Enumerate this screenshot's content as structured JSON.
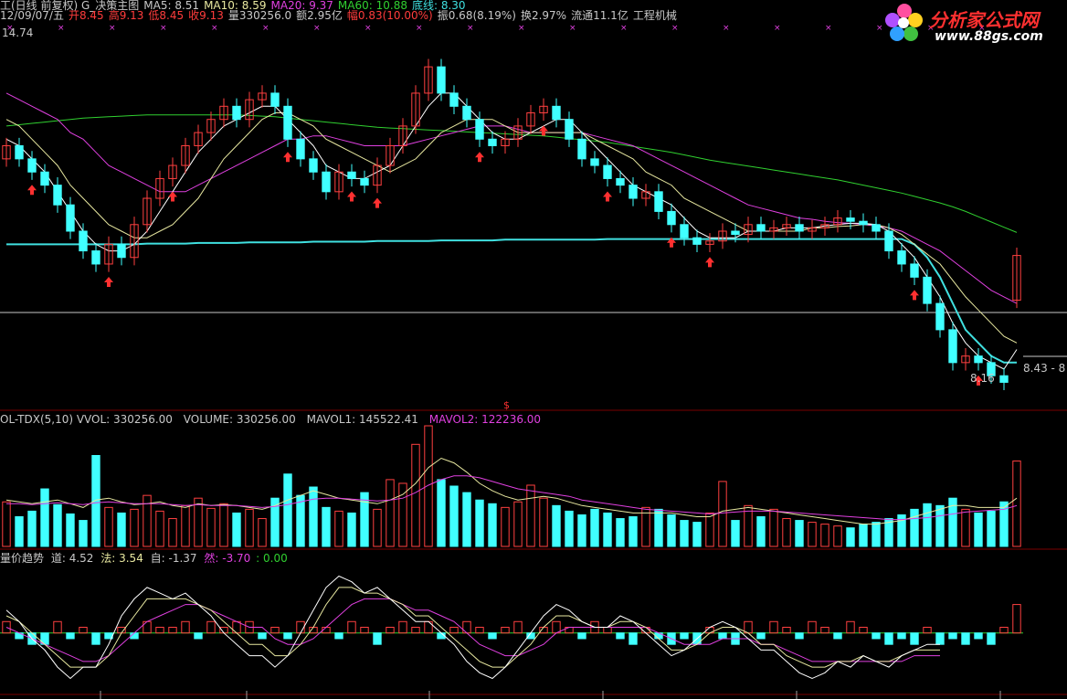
{
  "header": {
    "line1": [
      {
        "text": "工(日线 前复权) G_决策主图",
        "color": "#c8c8c8"
      },
      {
        "text": "MA5: 8.51",
        "color": "#c8c8c8"
      },
      {
        "text": "MA10: 8.59",
        "color": "#e8e8a0"
      },
      {
        "text": "MA20: 9.37",
        "color": "#e040e0"
      },
      {
        "text": "MA60: 10.88",
        "color": "#30d030"
      },
      {
        "text": "底线: 8.30",
        "color": "#40e0e0"
      }
    ],
    "line2": [
      {
        "text": "12/09/07/五",
        "color": "#c8c8c8"
      },
      {
        "text": "开8.45",
        "color": "#ff3c3c"
      },
      {
        "text": "高9.13",
        "color": "#ff3c3c"
      },
      {
        "text": "低8.45",
        "color": "#ff3c3c"
      },
      {
        "text": "收9.13",
        "color": "#ff3c3c"
      },
      {
        "text": "量330256.0",
        "color": "#c8c8c8"
      },
      {
        "text": "额2.95亿",
        "color": "#c8c8c8"
      },
      {
        "text": "幅0.83(10.00%)",
        "color": "#ff3c3c"
      },
      {
        "text": "振0.68(8.19%)",
        "color": "#c8c8c8"
      },
      {
        "text": "换2.97%",
        "color": "#c8c8c8"
      },
      {
        "text": "流通11.1亿",
        "color": "#c8c8c8"
      },
      {
        "text": "工程机械",
        "color": "#c8c8c8"
      }
    ]
  },
  "logo": {
    "title": "分析家公式网",
    "url": "www.88gs.com"
  },
  "chart_data": [
    {
      "type": "candlestick",
      "name": "price",
      "y_max_label": "14.74",
      "low_label": "8.16",
      "last_label": "8.43 - 8",
      "marker_label": "$",
      "close": [
        10.8,
        10.6,
        10.4,
        10.2,
        9.9,
        9.5,
        9.2,
        9.0,
        9.3,
        9.1,
        9.6,
        10.0,
        10.3,
        10.5,
        10.8,
        11.0,
        11.2,
        11.4,
        11.2,
        11.5,
        11.6,
        11.4,
        10.9,
        10.6,
        10.4,
        10.1,
        10.4,
        10.3,
        10.2,
        10.5,
        10.8,
        11.1,
        11.6,
        12.0,
        11.6,
        11.4,
        11.2,
        10.9,
        10.8,
        10.9,
        11.1,
        11.3,
        11.4,
        11.2,
        10.9,
        10.6,
        10.5,
        10.3,
        10.2,
        10.0,
        10.1,
        9.8,
        9.6,
        9.4,
        9.3,
        9.35,
        9.5,
        9.45,
        9.6,
        9.5,
        9.55,
        9.6,
        9.5,
        9.55,
        9.6,
        9.7,
        9.65,
        9.6,
        9.5,
        9.2,
        9.0,
        8.8,
        8.4,
        8.0,
        7.5,
        7.6,
        7.5,
        7.3,
        7.2,
        9.13
      ],
      "open": [
        10.6,
        10.8,
        10.6,
        10.4,
        10.2,
        9.9,
        9.5,
        9.2,
        9.0,
        9.3,
        9.1,
        9.6,
        10.0,
        10.3,
        10.5,
        10.8,
        11.0,
        11.2,
        11.4,
        11.2,
        11.5,
        11.6,
        11.4,
        10.9,
        10.6,
        10.4,
        10.1,
        10.4,
        10.3,
        10.2,
        10.5,
        10.8,
        11.1,
        11.6,
        12.0,
        11.6,
        11.4,
        11.2,
        10.9,
        10.8,
        10.9,
        11.1,
        11.3,
        11.4,
        11.2,
        10.9,
        10.6,
        10.5,
        10.3,
        10.2,
        10.0,
        10.1,
        9.8,
        9.6,
        9.4,
        9.3,
        9.35,
        9.5,
        9.45,
        9.6,
        9.5,
        9.55,
        9.6,
        9.5,
        9.55,
        9.6,
        9.7,
        9.65,
        9.6,
        9.5,
        9.2,
        9.0,
        8.8,
        8.4,
        8.0,
        7.5,
        7.6,
        7.5,
        7.3,
        8.45
      ],
      "ma5": [
        10.9,
        10.8,
        10.6,
        10.4,
        10.1,
        9.8,
        9.5,
        9.3,
        9.2,
        9.2,
        9.3,
        9.5,
        9.8,
        10.1,
        10.4,
        10.7,
        10.9,
        11.1,
        11.2,
        11.3,
        11.4,
        11.4,
        11.2,
        11.0,
        10.8,
        10.5,
        10.4,
        10.3,
        10.3,
        10.4,
        10.5,
        10.8,
        11.1,
        11.4,
        11.6,
        11.6,
        11.4,
        11.2,
        11.0,
        10.9,
        10.9,
        11.0,
        11.1,
        11.2,
        11.2,
        11.0,
        10.8,
        10.6,
        10.4,
        10.2,
        10.1,
        10.0,
        9.9,
        9.7,
        9.5,
        9.4,
        9.4,
        9.4,
        9.5,
        9.5,
        9.5,
        9.55,
        9.55,
        9.55,
        9.58,
        9.6,
        9.62,
        9.62,
        9.6,
        9.5,
        9.3,
        9.1,
        8.8,
        8.5,
        8.1,
        7.8,
        7.6,
        7.5,
        7.4,
        7.7
      ],
      "ma10": [
        11.2,
        11.1,
        10.9,
        10.7,
        10.5,
        10.2,
        10.0,
        9.8,
        9.6,
        9.5,
        9.4,
        9.4,
        9.5,
        9.6,
        9.8,
        10.0,
        10.3,
        10.6,
        10.8,
        11.0,
        11.2,
        11.3,
        11.3,
        11.2,
        11.1,
        10.9,
        10.8,
        10.7,
        10.6,
        10.5,
        10.4,
        10.5,
        10.6,
        10.8,
        11.0,
        11.1,
        11.2,
        11.2,
        11.2,
        11.1,
        11.0,
        11.0,
        11.0,
        11.0,
        11.0,
        11.0,
        10.9,
        10.8,
        10.7,
        10.6,
        10.4,
        10.3,
        10.2,
        10.0,
        9.9,
        9.8,
        9.7,
        9.6,
        9.5,
        9.5,
        9.5,
        9.5,
        9.5,
        9.55,
        9.55,
        9.57,
        9.58,
        9.6,
        9.6,
        9.55,
        9.45,
        9.3,
        9.15,
        9.0,
        8.75,
        8.5,
        8.3,
        8.1,
        7.9,
        7.8
      ],
      "ma20": [
        11.6,
        11.5,
        11.4,
        11.3,
        11.2,
        11.0,
        10.9,
        10.7,
        10.5,
        10.4,
        10.3,
        10.2,
        10.1,
        10.1,
        10.1,
        10.2,
        10.3,
        10.4,
        10.5,
        10.6,
        10.7,
        10.8,
        10.9,
        10.9,
        10.95,
        10.95,
        10.9,
        10.85,
        10.8,
        10.8,
        10.8,
        10.8,
        10.85,
        10.9,
        10.95,
        11.0,
        11.05,
        11.1,
        11.1,
        11.1,
        11.05,
        11.0,
        11.0,
        11.0,
        11.0,
        11.0,
        10.95,
        10.9,
        10.85,
        10.8,
        10.7,
        10.6,
        10.5,
        10.4,
        10.3,
        10.2,
        10.1,
        10.0,
        9.9,
        9.85,
        9.8,
        9.75,
        9.7,
        9.68,
        9.65,
        9.63,
        9.62,
        9.6,
        9.58,
        9.55,
        9.5,
        9.4,
        9.3,
        9.2,
        9.05,
        8.9,
        8.75,
        8.6,
        8.5,
        8.4
      ],
      "ma60": [
        11.1,
        11.12,
        11.14,
        11.16,
        11.18,
        11.2,
        11.22,
        11.23,
        11.24,
        11.25,
        11.26,
        11.27,
        11.27,
        11.27,
        11.27,
        11.27,
        11.27,
        11.27,
        11.27,
        11.26,
        11.25,
        11.24,
        11.22,
        11.2,
        11.18,
        11.16,
        11.14,
        11.12,
        11.1,
        11.08,
        11.07,
        11.06,
        11.05,
        11.04,
        11.03,
        11.02,
        11.01,
        11.0,
        10.99,
        10.98,
        10.97,
        10.96,
        10.95,
        10.93,
        10.91,
        10.89,
        10.87,
        10.85,
        10.82,
        10.79,
        10.76,
        10.73,
        10.7,
        10.66,
        10.62,
        10.58,
        10.55,
        10.52,
        10.49,
        10.46,
        10.43,
        10.4,
        10.37,
        10.34,
        10.31,
        10.28,
        10.24,
        10.2,
        10.16,
        10.12,
        10.08,
        10.03,
        9.98,
        9.93,
        9.87,
        9.8,
        9.72,
        9.64,
        9.56,
        9.48
      ],
      "base": [
        9.3,
        9.3,
        9.3,
        9.3,
        9.3,
        9.3,
        9.3,
        9.3,
        9.3,
        9.3,
        9.3,
        9.31,
        9.31,
        9.31,
        9.31,
        9.32,
        9.32,
        9.32,
        9.32,
        9.33,
        9.33,
        9.33,
        9.33,
        9.33,
        9.34,
        9.34,
        9.34,
        9.34,
        9.34,
        9.35,
        9.35,
        9.35,
        9.35,
        9.35,
        9.36,
        9.36,
        9.36,
        9.36,
        9.36,
        9.37,
        9.37,
        9.37,
        9.37,
        9.37,
        9.37,
        9.37,
        9.37,
        9.38,
        9.38,
        9.38,
        9.38,
        9.38,
        9.38,
        9.38,
        9.38,
        9.38,
        9.38,
        9.38,
        9.38,
        9.38,
        9.38,
        9.38,
        9.38,
        9.38,
        9.38,
        9.38,
        9.38,
        9.38,
        9.38,
        9.38,
        9.38,
        9.3,
        9.1,
        8.8,
        8.4,
        8.0,
        7.8,
        7.6,
        7.5,
        7.5
      ],
      "buy_signals": [
        2,
        8,
        13,
        22,
        27,
        29,
        37,
        42,
        47,
        52,
        55,
        71,
        76
      ],
      "ylim": [
        6.9,
        12.6
      ]
    },
    {
      "type": "bar",
      "name": "volume",
      "label": "OL-TDX(5,10) VVOL: 330256.00",
      "label_volume": "VOLUME: 330256.00",
      "label_mavol1": "MAVOL1: 145522.41",
      "label_mavol2": "MAVOL2: 122236.00",
      "values": [
        48,
        32,
        38,
        62,
        45,
        35,
        28,
        98,
        42,
        36,
        40,
        55,
        38,
        30,
        44,
        52,
        41,
        46,
        36,
        40,
        30,
        52,
        78,
        55,
        64,
        42,
        38,
        36,
        58,
        40,
        72,
        68,
        110,
        130,
        72,
        65,
        58,
        50,
        46,
        42,
        48,
        66,
        52,
        44,
        38,
        34,
        40,
        36,
        30,
        32,
        42,
        40,
        34,
        28,
        26,
        36,
        70,
        28,
        44,
        32,
        40,
        30,
        28,
        26,
        24,
        22,
        20,
        24,
        26,
        30,
        34,
        40,
        46,
        44,
        52,
        40,
        36,
        38,
        48,
        92
      ],
      "mavol1": [
        50,
        48,
        46,
        48,
        50,
        46,
        42,
        50,
        52,
        48,
        45,
        46,
        48,
        44,
        42,
        46,
        44,
        45,
        44,
        42,
        40,
        44,
        50,
        55,
        60,
        56,
        52,
        50,
        48,
        46,
        50,
        56,
        68,
        85,
        95,
        90,
        80,
        68,
        60,
        54,
        50,
        52,
        54,
        52,
        48,
        44,
        42,
        40,
        38,
        36,
        36,
        36,
        36,
        34,
        32,
        32,
        38,
        40,
        42,
        40,
        38,
        36,
        34,
        32,
        30,
        28,
        26,
        24,
        24,
        26,
        28,
        32,
        36,
        40,
        44,
        44,
        42,
        42,
        42,
        52
      ],
      "mavol2": [
        46,
        46,
        45,
        46,
        47,
        46,
        45,
        47,
        48,
        47,
        46,
        46,
        46,
        45,
        44,
        45,
        44,
        44,
        44,
        43,
        42,
        43,
        45,
        48,
        51,
        52,
        52,
        51,
        50,
        49,
        50,
        52,
        58,
        66,
        72,
        76,
        76,
        74,
        70,
        66,
        62,
        60,
        58,
        56,
        54,
        50,
        48,
        46,
        44,
        42,
        40,
        39,
        38,
        37,
        36,
        35,
        36,
        37,
        38,
        38,
        38,
        37,
        36,
        35,
        34,
        33,
        32,
        31,
        30,
        29,
        29,
        30,
        31,
        33,
        35,
        37,
        38,
        39,
        40,
        44
      ],
      "colors": {
        "up": "#ff4040",
        "down": "#40ffff"
      }
    },
    {
      "type": "bar+line",
      "name": "trend",
      "title": "量价趋势",
      "label_dao": "道: 4.52",
      "label_fa": "法: 3.54",
      "label_zi": "自: -1.37",
      "label_ran": "然: -3.70",
      "label_zero": ": 0.00",
      "bars": [
        2,
        -1,
        -2,
        -2,
        2,
        -1,
        1,
        -2,
        -1,
        1,
        -1,
        2,
        1,
        1,
        2,
        -1,
        2,
        1,
        2,
        2,
        -1,
        1,
        -1,
        2,
        1,
        1,
        -1,
        2,
        1,
        -2,
        1,
        2,
        1,
        2,
        -1,
        1,
        2,
        1,
        -1,
        1,
        2,
        -1,
        1,
        2,
        1,
        -1,
        2,
        1,
        -1,
        -2,
        1,
        -1,
        -2,
        -1,
        -2,
        1,
        -1,
        -2,
        2,
        -1,
        2,
        1,
        -1,
        2,
        1,
        -1,
        2,
        1,
        -1,
        -2,
        -1,
        -2,
        1,
        -2,
        -1,
        -2,
        -1,
        -2,
        1,
        5
      ],
      "line_white": [
        4,
        2,
        -1,
        -3,
        -6,
        -8,
        -6,
        -2,
        3,
        6,
        8,
        7,
        6,
        7,
        5,
        3,
        0,
        -2,
        -4,
        -6,
        -4,
        0,
        4,
        8,
        10,
        9,
        7,
        8,
        6,
        4,
        2,
        0,
        -2,
        -5,
        -7,
        -8,
        -6,
        -3,
        0,
        3,
        5,
        4,
        2,
        1,
        3,
        2,
        0,
        -2,
        -4,
        -3,
        -1,
        1,
        2,
        1,
        -1,
        -3,
        -5,
        -7,
        -8,
        -7,
        -5,
        -6,
        -4,
        -5,
        -6,
        -4,
        -3,
        -2,
        -4,
        -3,
        -2,
        -1,
        0,
        4
      ],
      "line_yellow": [
        3,
        2,
        0,
        -2,
        -4,
        -6,
        -6,
        -4,
        0,
        3,
        6,
        6,
        6,
        6,
        5,
        4,
        2,
        0,
        -2,
        -4,
        -4,
        -2,
        1,
        5,
        8,
        8,
        7,
        7,
        6,
        5,
        3,
        1,
        -1,
        -3,
        -5,
        -6,
        -6,
        -4,
        -2,
        1,
        3,
        3,
        2,
        1,
        2,
        2,
        1,
        -1,
        -3,
        -3,
        -2,
        0,
        1,
        1,
        0,
        -2,
        -4,
        -5,
        -6,
        -6,
        -5,
        -5,
        -4,
        -5,
        -5,
        -4,
        -3,
        -3,
        -3,
        -3,
        -2,
        -1,
        0,
        3
      ],
      "line_magenta": [
        1,
        0,
        -1,
        -2,
        -3,
        -4,
        -5,
        -4,
        -2,
        0,
        2,
        3,
        4,
        5,
        5,
        4,
        3,
        2,
        1,
        -1,
        -2,
        -2,
        -1,
        1,
        3,
        5,
        6,
        6,
        6,
        5,
        4,
        3,
        2,
        0,
        -2,
        -3,
        -4,
        -4,
        -3,
        -2,
        0,
        1,
        1,
        1,
        1,
        1,
        1,
        0,
        -1,
        -2,
        -2,
        -2,
        -1,
        -1,
        -1,
        -2,
        -3,
        -4,
        -5,
        -5,
        -5,
        -5,
        -5,
        -5,
        -5,
        -5,
        -4,
        -4,
        -4,
        -3,
        -3,
        -2,
        -2,
        0
      ],
      "ylim": [
        -10,
        12
      ]
    }
  ]
}
